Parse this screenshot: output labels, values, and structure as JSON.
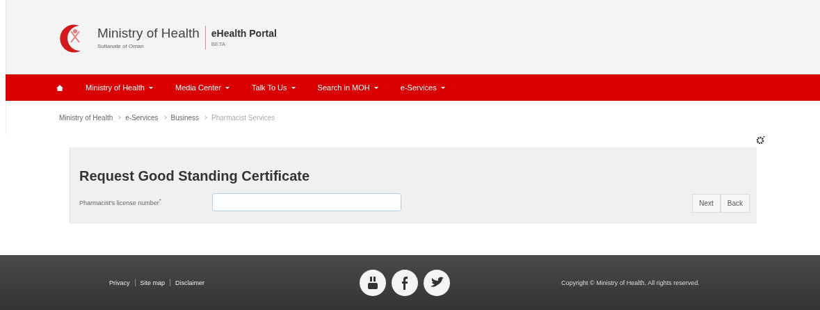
{
  "header": {
    "title": "Ministry of Health",
    "subtitle": "Sultanate of Oman",
    "portal": "eHealth Portal",
    "badge": "BETA"
  },
  "nav": {
    "items": [
      {
        "label": "Ministry of Health",
        "dropdown": true
      },
      {
        "label": "Media Center",
        "dropdown": true
      },
      {
        "label": "Talk To Us",
        "dropdown": true
      },
      {
        "label": "Search in MOH",
        "dropdown": true
      },
      {
        "label": "e-Services",
        "dropdown": true
      }
    ]
  },
  "breadcrumb": [
    {
      "label": "Ministry of Health",
      "current": false
    },
    {
      "label": "e-Services",
      "current": false
    },
    {
      "label": "Business",
      "current": false
    },
    {
      "label": "Pharmacist Services",
      "current": true
    }
  ],
  "form": {
    "title": "Request Good Standing Certificate",
    "field_label": "Pharmacist's license number$^{*}$",
    "buttons": [
      "Next",
      "Back"
    ]
  },
  "footer": {
    "links": [
      "Privacy",
      "Site map",
      "Disclaimer"
    ],
    "copyright": "Copyright © Ministry of Health. All rights reserved."
  }
}
